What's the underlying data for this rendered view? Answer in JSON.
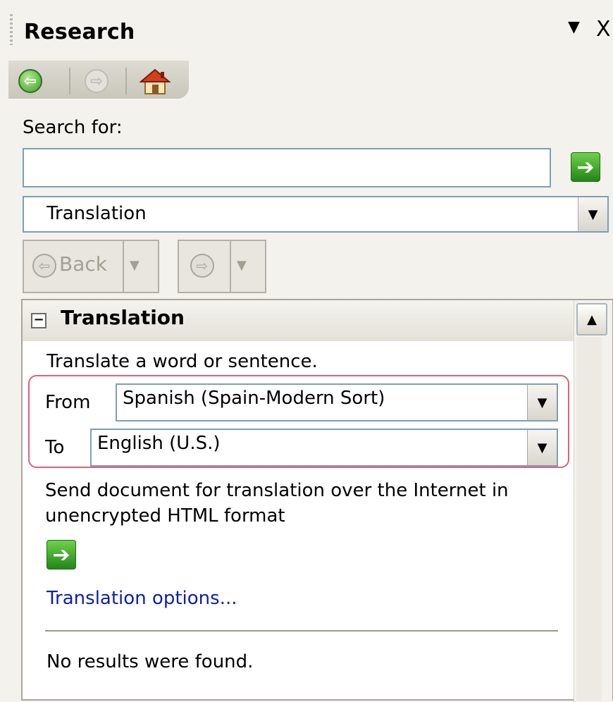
{
  "pane": {
    "title": "Research",
    "menu_glyph": "▼",
    "close_glyph": "X"
  },
  "mini_toolbar": {
    "back_glyph": "⇦",
    "forward_glyph": "⇨"
  },
  "search": {
    "label": "Search for:",
    "value": "",
    "go_glyph": "➔",
    "source_selected": "Translation",
    "dropdown_glyph": "▼"
  },
  "history": {
    "back_label": "Back",
    "back_glyph": "⇦",
    "forward_glyph": "⇨",
    "dropdown_glyph": "▼"
  },
  "results": {
    "section_title": "Translation",
    "collapse_glyph": "−",
    "description": "Translate a word or sentence.",
    "from_label": "From",
    "from_value": "Spanish (Spain-Modern Sort)",
    "to_label": "To",
    "to_value": "English (U.S.)",
    "send_text": "Send document for translation over the Internet in unencrypted HTML format",
    "go_glyph": "➔",
    "options_link": "Translation options...",
    "no_results": "No results were found.",
    "scroll_up_glyph": "▲"
  },
  "colors": {
    "accent_green": "#22861a",
    "link_blue": "#0f1fa8",
    "highlight_red": "#e0607a"
  }
}
